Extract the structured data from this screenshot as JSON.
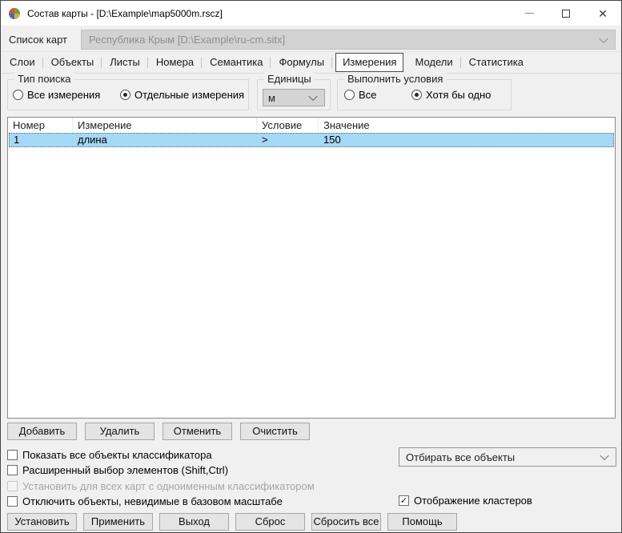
{
  "window": {
    "title": "Состав карты - [D:\\Example\\map5000m.rscz]"
  },
  "icons": {
    "app": "panorama-map-globe",
    "combo": "chevron-down"
  },
  "colors": {
    "selection_blue": "#a5d8f5",
    "dialog_bg": "#f0f0f0",
    "disabled_combo_bg": "#d2d2d2"
  },
  "map_list": {
    "label": "Список карт",
    "value": "Республика Крым [D:\\Example\\ru-cm.sitx]"
  },
  "tabs": [
    {
      "label": "Слои",
      "selected": false
    },
    {
      "label": "Объекты",
      "selected": false
    },
    {
      "label": "Листы",
      "selected": false
    },
    {
      "label": "Номера",
      "selected": false
    },
    {
      "label": "Семантика",
      "selected": false
    },
    {
      "label": "Формулы",
      "selected": false
    },
    {
      "label": "Измерения",
      "selected": true
    },
    {
      "label": "Модели",
      "selected": false
    },
    {
      "label": "Статистика",
      "selected": false
    }
  ],
  "search_type": {
    "legend": "Тип поиска",
    "options": [
      {
        "label": "Все измерения",
        "selected": false
      },
      {
        "label": "Отдельные измерения",
        "selected": true
      }
    ]
  },
  "units": {
    "legend": "Единицы",
    "value": "м"
  },
  "conditions": {
    "legend": "Выполнить условия",
    "options": [
      {
        "label": "Все",
        "selected": false
      },
      {
        "label": "Хотя бы одно",
        "selected": true
      }
    ]
  },
  "table": {
    "columns": [
      "Номер",
      "Измерение",
      "Условие",
      "Значение"
    ],
    "rows": [
      [
        "1",
        "длина",
        ">",
        "150"
      ]
    ]
  },
  "row_buttons": [
    "Добавить",
    "Удалить",
    "Отменить",
    "Очистить"
  ],
  "checkboxes": [
    {
      "label": "Показать все объекты классификатора",
      "checked": false,
      "disabled": false
    },
    {
      "label": "Расширенный выбор элементов (Shift,Ctrl)",
      "checked": false,
      "disabled": false
    },
    {
      "label": "Установить для всех карт с одноименным классификатором",
      "checked": false,
      "disabled": true
    },
    {
      "label": "Отключить объекты, невидимые в базовом масштабе",
      "checked": false,
      "disabled": false
    }
  ],
  "select_mode": {
    "value": "Отбирать все объекты"
  },
  "clusters": {
    "label": "Отображение кластеров",
    "checked": true,
    "check_glyph": "✓"
  },
  "bottom_buttons": [
    "Установить",
    "Применить",
    "Выход",
    "Сброс",
    "Сбросить все",
    "Помощь"
  ]
}
